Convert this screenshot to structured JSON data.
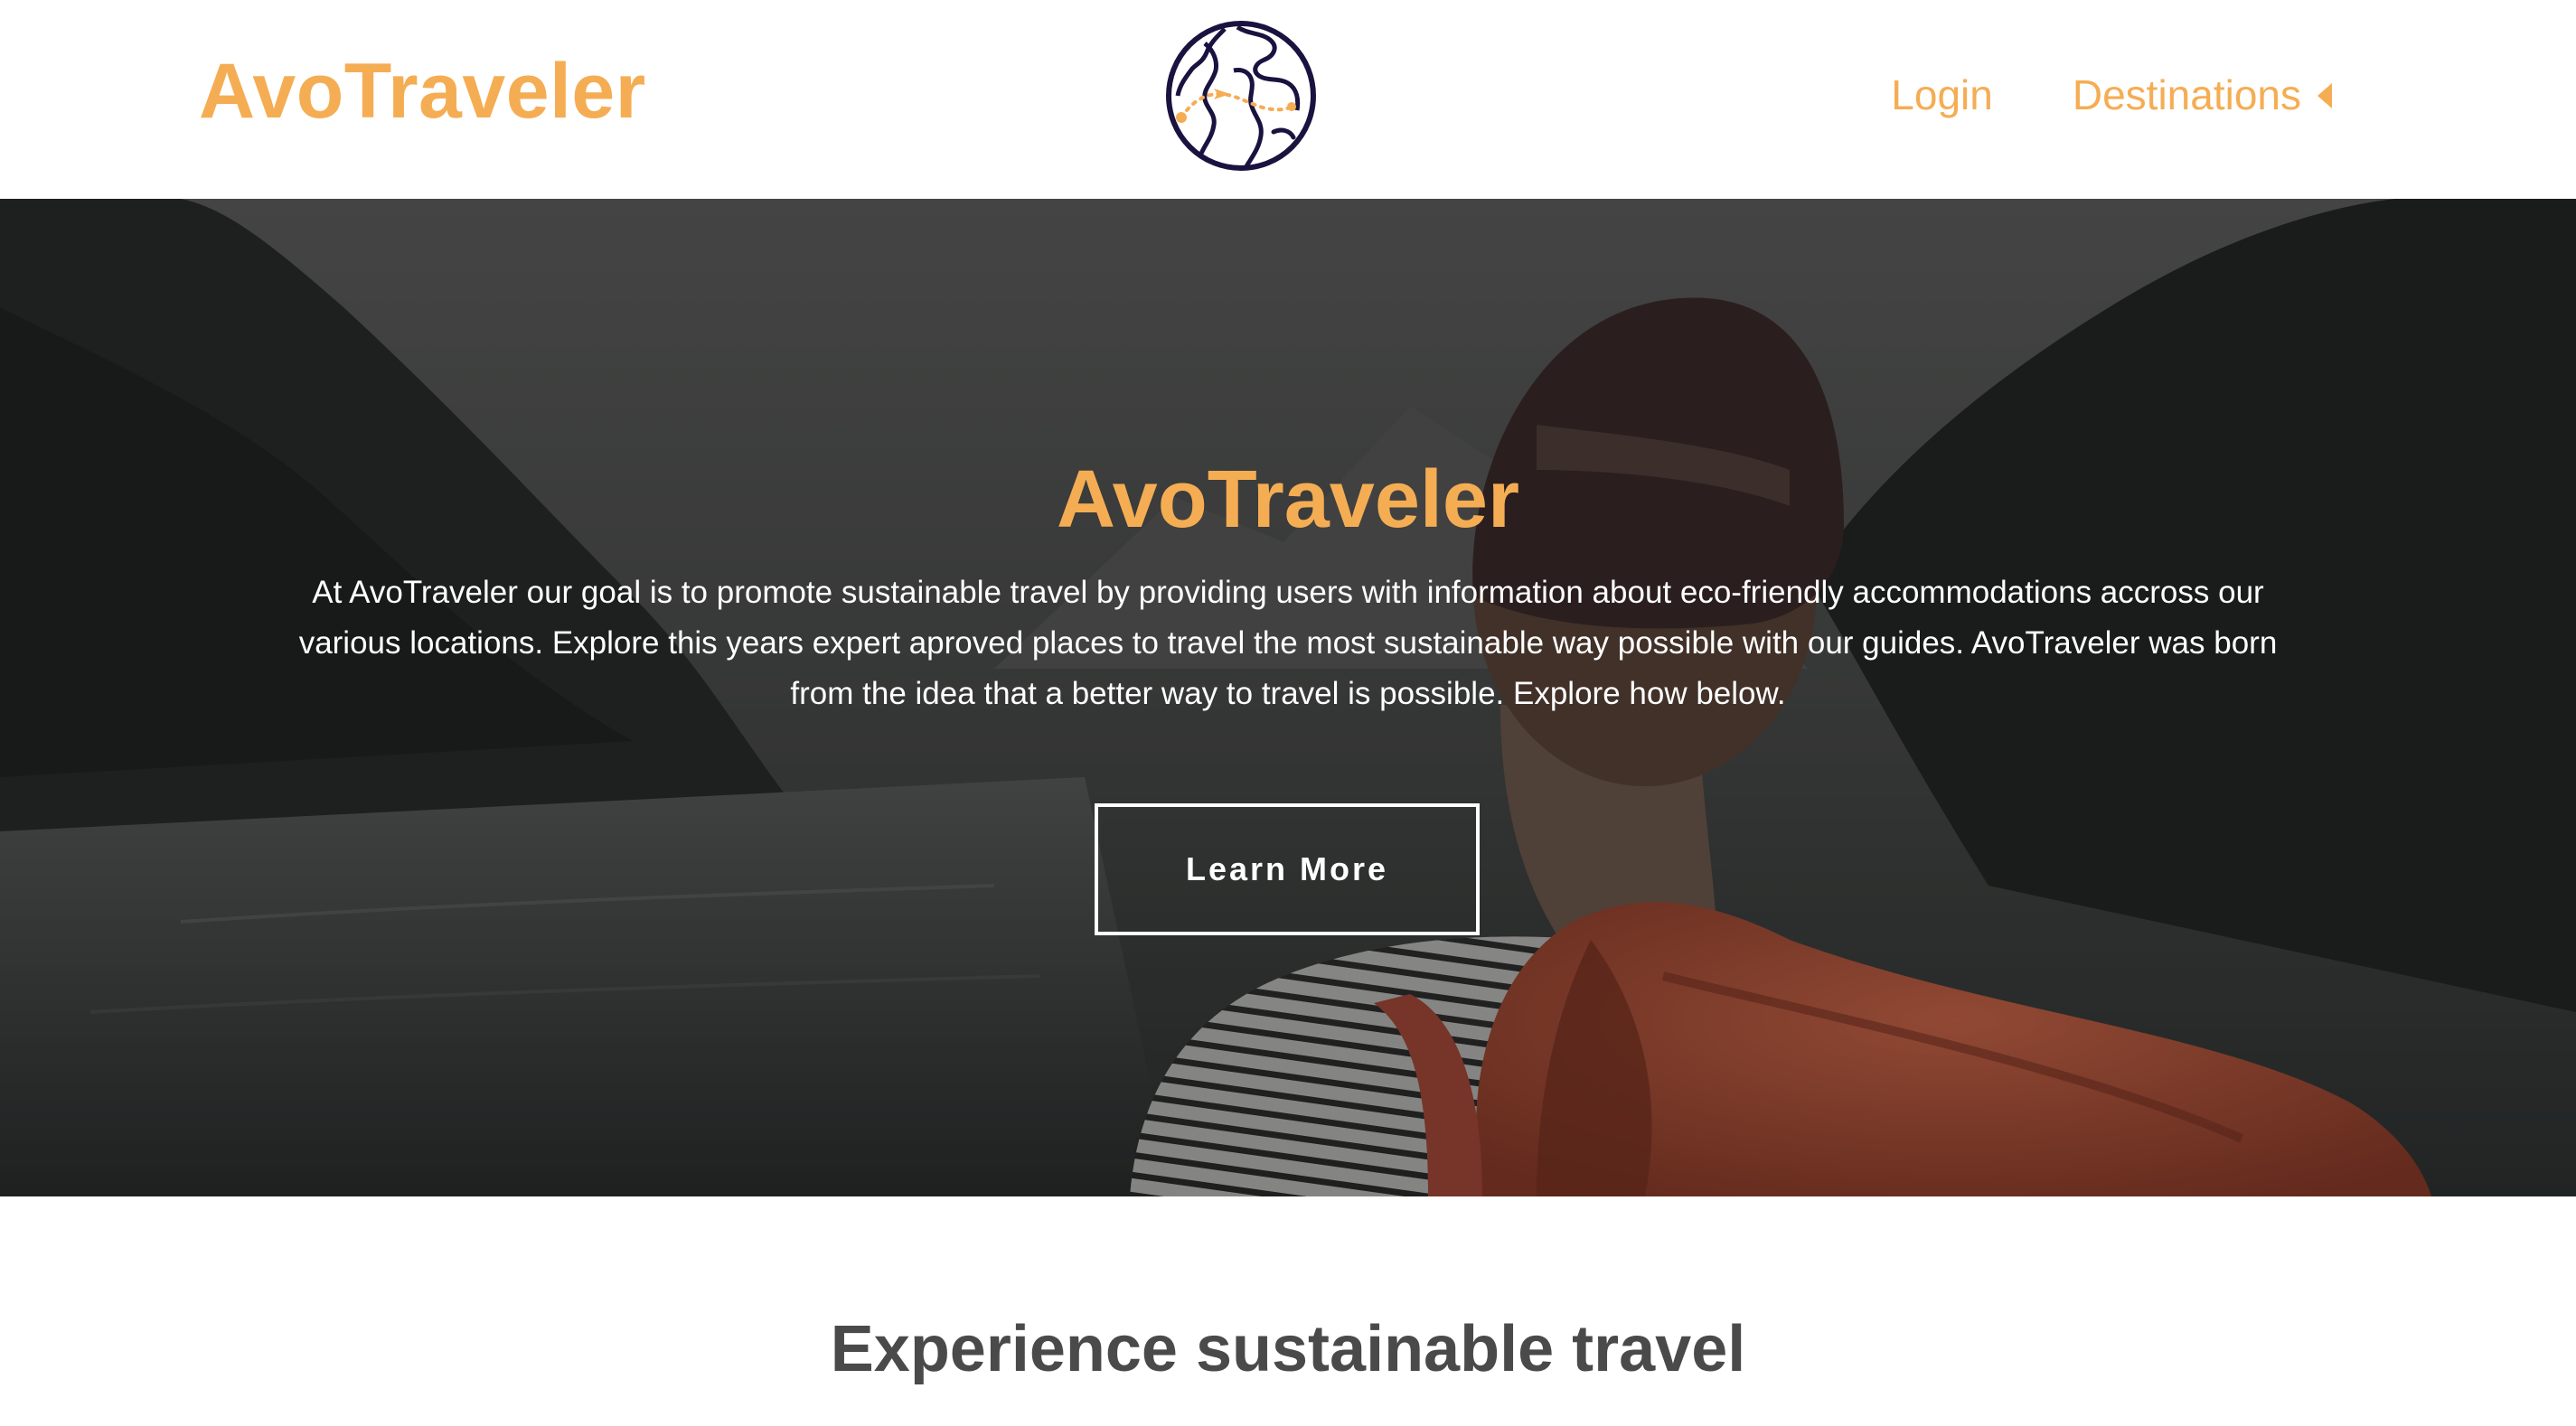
{
  "header": {
    "brand": "AvoTraveler",
    "logo_icon": "globe-route-icon",
    "nav": {
      "login_label": "Login",
      "destinations_label": "Destinations",
      "destinations_icon": "caret-left-icon"
    }
  },
  "hero": {
    "title": "AvoTraveler",
    "description": "At AvoTraveler our goal is to promote sustainable travel by providing users with information about eco-friendly accommodations accross our various locations. Explore this years expert aproved places to travel the most sustainable way possible with our guides. AvoTraveler was born from the idea that a better way to travel is possible. Explore how below.",
    "button_label": "Learn More"
  },
  "section": {
    "title": "Experience sustainable travel"
  },
  "colors": {
    "accent": "#f5ad54",
    "logo_stroke": "#1a1340",
    "hero_text": "#ffffff",
    "heading": "#4a4a4a"
  }
}
